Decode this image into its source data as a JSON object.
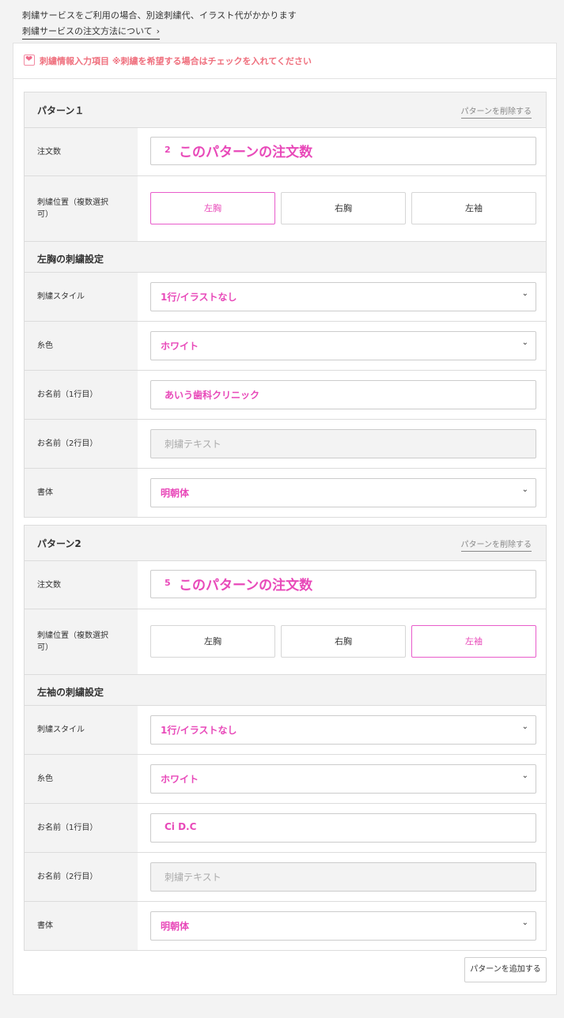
{
  "notice": "刺繍サービスをご利用の場合、別途刺繍代、イラスト代がかかります",
  "order_link": "刺繍サービスの注文方法について",
  "checkbox_label": "刺繍情報入力項目 ※刺繍を希望する場合はチェックを入れてください",
  "checkbox_checked": true,
  "labels": {
    "quantity": "注文数",
    "position": "刺繍位置（複数選択可）",
    "style": "刺繍スタイル",
    "thread_color": "糸色",
    "name1": "お名前（1行目）",
    "name2": "お名前（2行目）",
    "font": "書体"
  },
  "delete_label": "パターンを削除する",
  "add_label": "パターンを追加する",
  "quantity_placeholder": "このパターンの注文数",
  "name2_placeholder": "刺繍テキスト",
  "positions": [
    "左胸",
    "右胸",
    "左袖"
  ],
  "patterns": [
    {
      "title": "パターン１",
      "quantity": "2",
      "active_position": "左胸",
      "settings_title": "左胸の刺繍設定",
      "style": "1行/イラストなし",
      "thread_color": "ホワイト",
      "name1": "あいう歯科クリニック",
      "font": "明朝体"
    },
    {
      "title": "パターン2",
      "quantity": "5",
      "active_position": "左袖",
      "settings_title": "左袖の刺繍設定",
      "style": "1行/イラストなし",
      "thread_color": "ホワイト",
      "name1": "Ci D.C",
      "font": "明朝体"
    }
  ],
  "colors": {
    "accent": "#e849b9",
    "notice_red": "#ef6f7d",
    "border": "#dcdcdc",
    "label_bg": "#f3f3f3"
  }
}
